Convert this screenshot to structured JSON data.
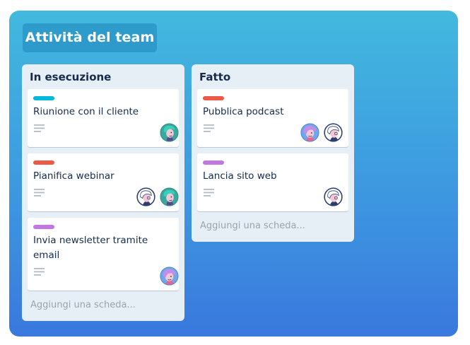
{
  "board": {
    "title": "Attività del team"
  },
  "lists": [
    {
      "title": "In esecuzione",
      "add_card": "Aggiungi una scheda...",
      "cards": [
        {
          "title": "Riunione con il cliente",
          "label_color": "#00b8d9",
          "avatars": [
            "teal-haired avatar"
          ]
        },
        {
          "title": "Pianifica webinar",
          "label_color": "#eb5a46",
          "avatars": [
            "white-haired avatar",
            "teal-haired avatar"
          ]
        },
        {
          "title": "Invia newsletter tramite email",
          "label_color": "#c377e0",
          "avatars": [
            "pink-haired avatar"
          ]
        }
      ]
    },
    {
      "title": "Fatto",
      "add_card": "Aggiungi una scheda...",
      "cards": [
        {
          "title": "Pubblica podcast",
          "label_color": "#eb5a46",
          "avatars": [
            "pink-haired avatar",
            "white-haired avatar"
          ]
        },
        {
          "title": "Lancia sito web",
          "label_color": "#c377e0",
          "avatars": [
            "white-haired avatar"
          ]
        }
      ]
    }
  ]
}
